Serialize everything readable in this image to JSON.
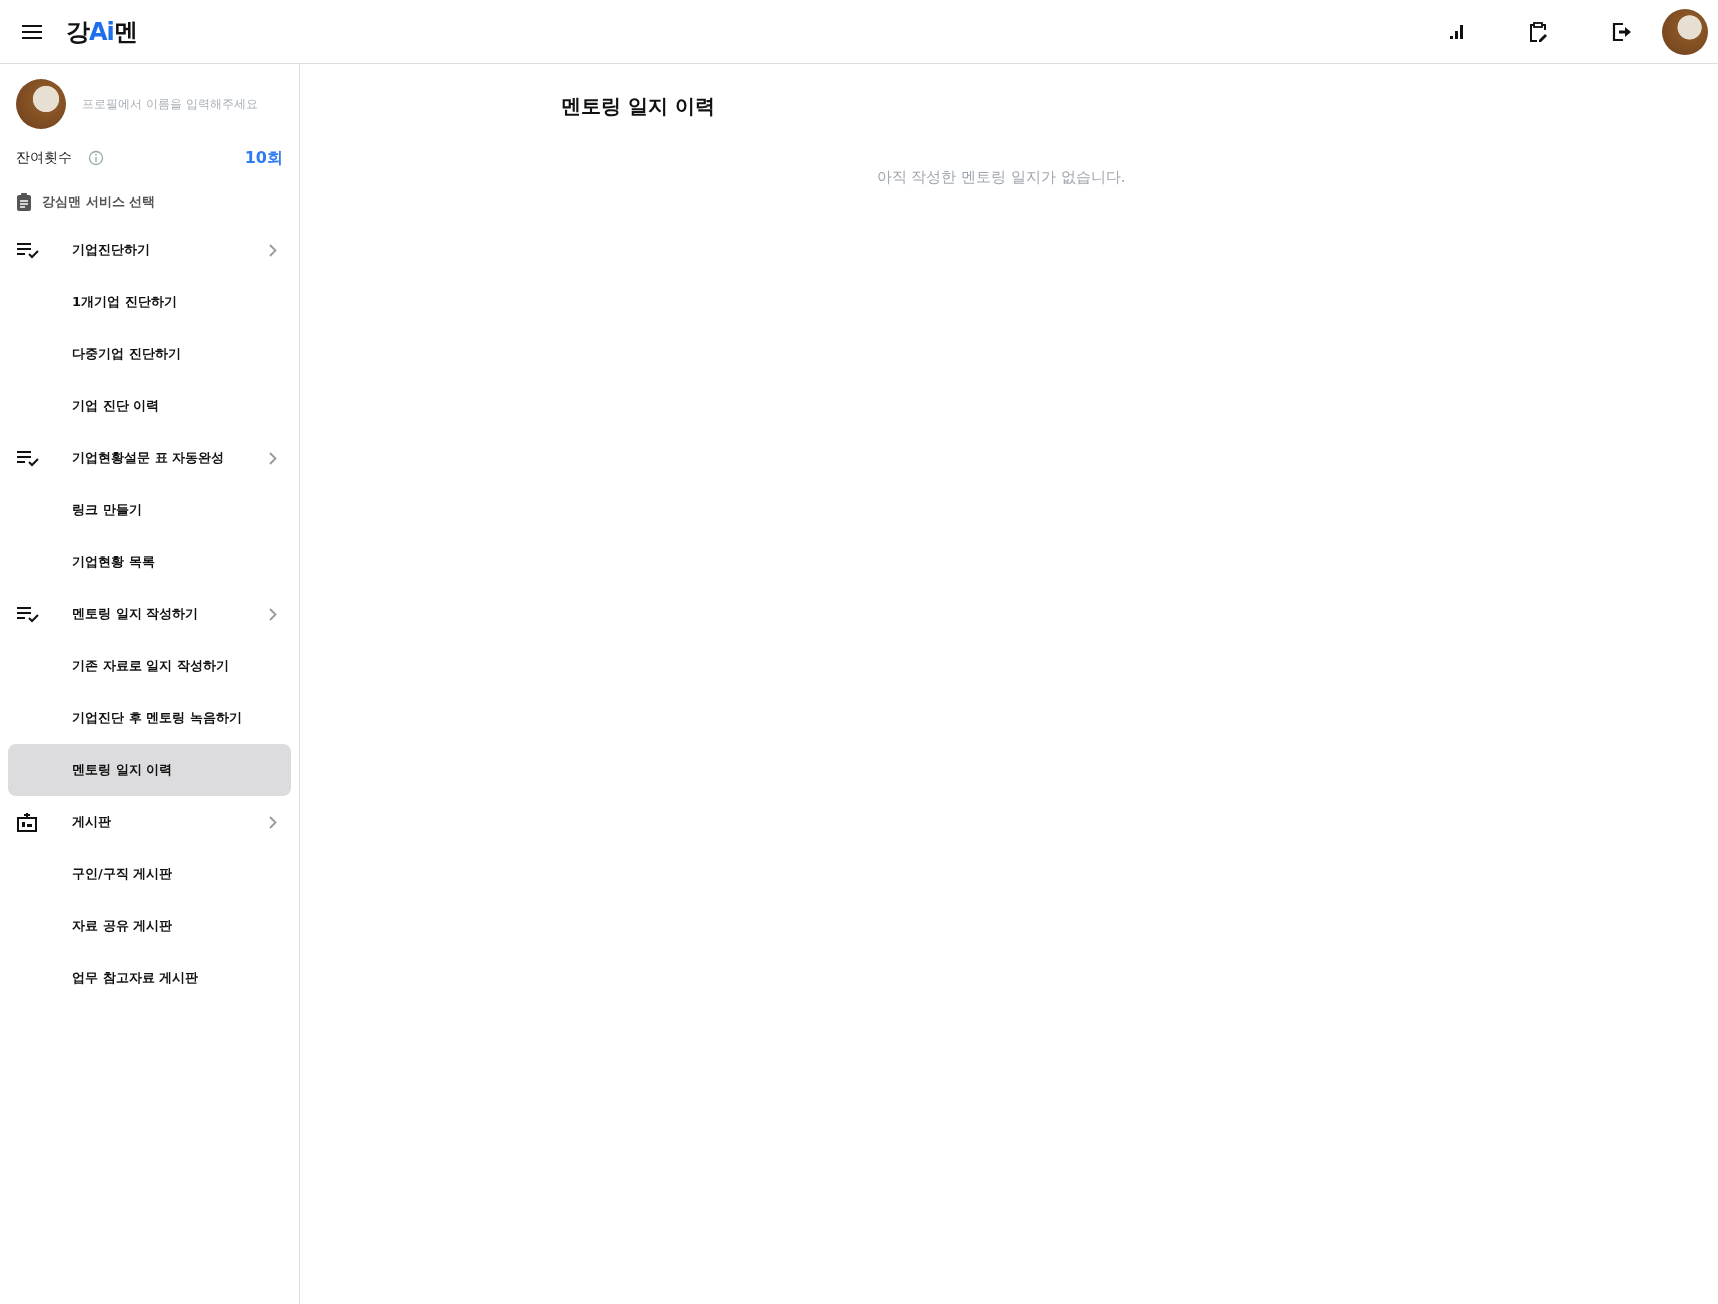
{
  "header": {
    "logo": [
      {
        "text": "강",
        "kind": "plain"
      },
      {
        "text": "Ai",
        "kind": "accent"
      },
      {
        "text": "멘",
        "kind": "plain"
      }
    ]
  },
  "sidebar": {
    "profile": {
      "name_hint": "프로필에서 이름을 입력해주세요"
    },
    "remaining": {
      "label": "잔여횟수",
      "value": "10회"
    },
    "section_title": "강심맨 서비스 선택",
    "groups": [
      {
        "label": "기업진단하기",
        "kind": "checklist",
        "items": [
          {
            "label": "1개기업 진단하기",
            "selected": false
          },
          {
            "label": "다중기업 진단하기",
            "selected": false
          },
          {
            "label": "기업 진단 이력",
            "selected": false
          }
        ]
      },
      {
        "label": "기업현황설문 표 자동완성",
        "kind": "checklist",
        "items": [
          {
            "label": "링크 만들기",
            "selected": false
          },
          {
            "label": "기업현황 목록",
            "selected": false
          }
        ]
      },
      {
        "label": "멘토링 일지 작성하기",
        "kind": "checklist",
        "items": [
          {
            "label": "기존 자료로 일지 작성하기",
            "selected": false
          },
          {
            "label": "기업진단 후 멘토링 녹음하기",
            "selected": false
          },
          {
            "label": "멘토링 일지 이력",
            "selected": true
          }
        ]
      },
      {
        "label": "게시판",
        "kind": "building",
        "items": [
          {
            "label": "구인/구직 게시판",
            "selected": false
          },
          {
            "label": "자료 공유 게시판",
            "selected": false
          },
          {
            "label": "업무 참고자료 게시판",
            "selected": false
          }
        ]
      }
    ]
  },
  "main": {
    "title": "멘토링 일지 이력",
    "empty_message": "아직 작성한 멘토링 일지가 없습니다."
  }
}
